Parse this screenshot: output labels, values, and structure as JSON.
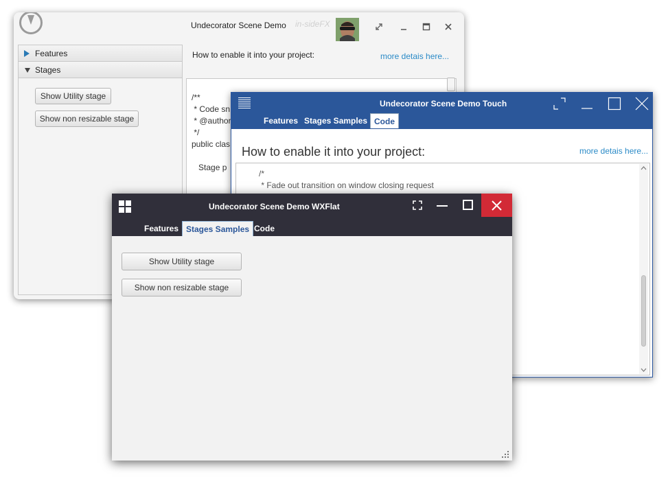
{
  "window_default": {
    "title": "Undecorator Scene Demo",
    "subtitle": "in-sideFX",
    "accordion": {
      "features_label": "Features",
      "stages_label": "Stages"
    },
    "buttons": {
      "utility": "Show Utility stage",
      "non_resizable": "Show non resizable stage"
    },
    "instruction": "How to enable it into your project:",
    "details_link": "more detais here...",
    "code_lines": [
      "/**",
      " * Code sn",
      " * @author",
      " */",
      "public clas",
      "",
      "   Stage p"
    ]
  },
  "window_touch": {
    "title": "Undecorator Scene Demo Touch",
    "tabs": [
      "Features",
      "Stages Samples",
      "Code"
    ],
    "active_tab": "Code",
    "heading": "How to enable it into your project:",
    "details_link": "more detais here...",
    "code_lines": [
      "/*",
      " * Fade out transition on window closing request"
    ]
  },
  "window_wxflat": {
    "title": "Undecorator Scene Demo WXFlat",
    "tabs": [
      "Features",
      "Stages Samples",
      "Code"
    ],
    "active_tab": "Stages Samples",
    "buttons": {
      "utility": "Show Utility stage",
      "non_resizable": "Show non resizable stage"
    }
  },
  "colors": {
    "touch_header": "#2b579a",
    "wxflat_header": "#302f3a",
    "wxflat_close": "#d22a36",
    "link": "#2a8ac7"
  },
  "icons": [
    "undecorator-logo-icon",
    "fullscreen-icon",
    "minimize-icon",
    "maximize-icon",
    "close-icon",
    "hamburger-menu-icon",
    "windows-logo-icon",
    "resize-grip-icon"
  ]
}
